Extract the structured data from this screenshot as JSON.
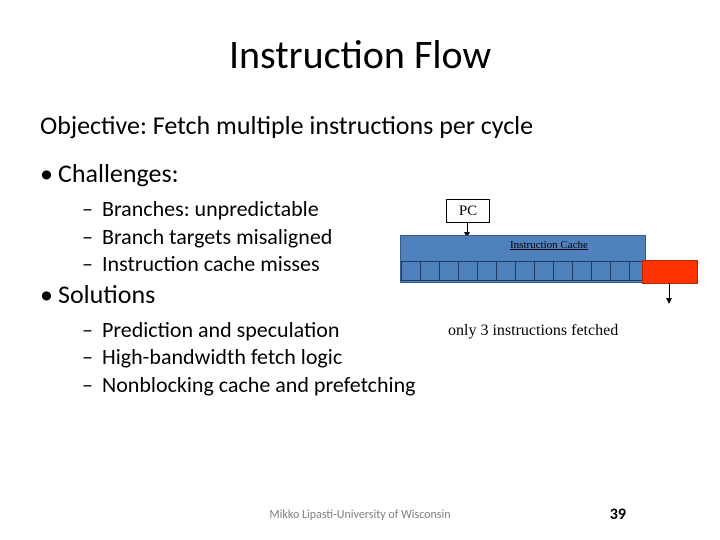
{
  "title": "Instruction Flow",
  "objective": "Objective: Fetch multiple instructions per cycle",
  "challenges": {
    "heading": "Challenges:",
    "items": [
      "Branches: unpredictable",
      "Branch targets misaligned",
      "Instruction cache misses"
    ]
  },
  "solutions": {
    "heading": "Solutions",
    "items": [
      "Prediction and speculation",
      "High-bandwidth fetch logic",
      "Nonblocking cache and prefetching"
    ]
  },
  "diagram": {
    "pc_label": "PC",
    "cache_label": "Instruction Cache",
    "caption": "only 3 instructions fetched"
  },
  "footer": "Mikko Lipasti-University of Wisconsin",
  "page_number": "39"
}
